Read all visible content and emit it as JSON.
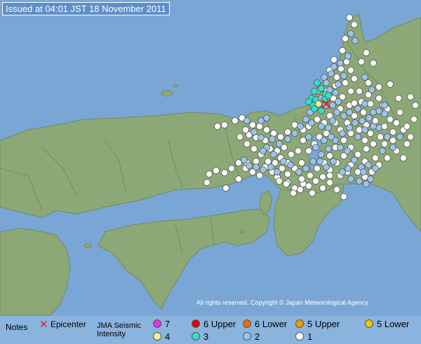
{
  "title": "Issued at 04:01 JST  18 November 2011",
  "copyright": "All rights reserved. Copyright © Japan Meteorological Agency",
  "legend": {
    "notes_label": "Notes",
    "epicenter_label": "Epicenter",
    "scale_label_1": "JMA Seismic",
    "scale_label_2": "Intensity",
    "items": [
      {
        "label": "7",
        "color": "#e632e6"
      },
      {
        "label": "6 Upper",
        "color": "#e00000"
      },
      {
        "label": "6 Lower",
        "color": "#f06a00"
      },
      {
        "label": "5 Upper",
        "color": "#f0a000"
      },
      {
        "label": "5 Lower",
        "color": "#f0c800"
      },
      {
        "label": "4",
        "color": "#f8f088"
      },
      {
        "label": "3",
        "color": "#30e0c8"
      },
      {
        "label": "2",
        "color": "#9ac4ee"
      },
      {
        "label": "1",
        "color": "#ffffff"
      }
    ]
  },
  "colors": {
    "sea": "#7aa6d6",
    "land": "#8da877",
    "epicenter": "#e02020"
  }
}
